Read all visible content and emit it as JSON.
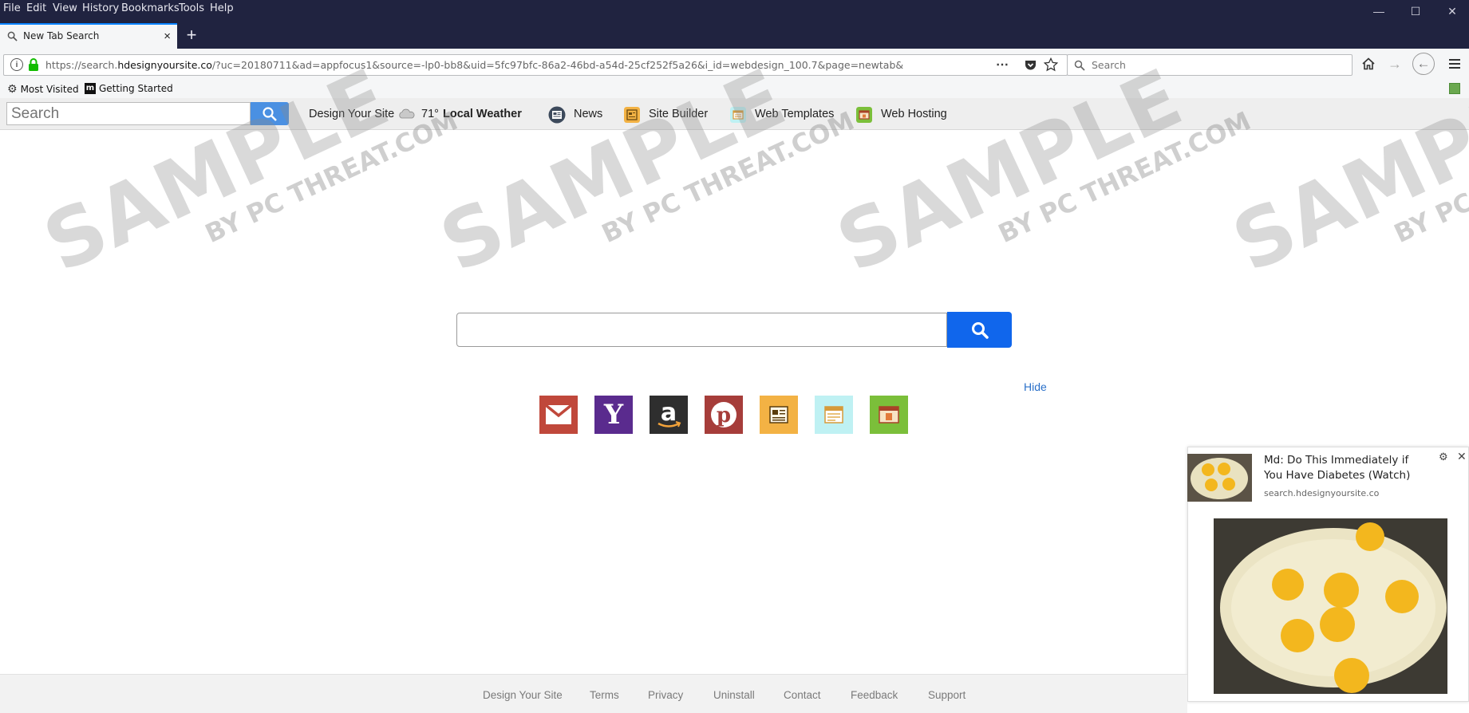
{
  "menu": [
    "File",
    "Edit",
    "View",
    "History",
    "Bookmarks",
    "Tools",
    "Help"
  ],
  "tab": {
    "title": "New Tab Search",
    "close": "×",
    "new_tab": "+"
  },
  "url": {
    "prefix": "https://search.",
    "domain": "hdesignyoursite.co",
    "rest": "/?uc=20180711&ad=appfocus1&source=-lp0-bb8&uid=5fc97bfc-86a2-46bd-a54d-25cf252f5a26&i_id=webdesign_100.7&page=newtab&"
  },
  "browser_search": {
    "placeholder": "Search"
  },
  "bookmarks": [
    {
      "label": "Most Visited",
      "icon": "gear-icon"
    },
    {
      "label": "Getting Started",
      "icon": "m-logo-icon"
    }
  ],
  "toolbar": {
    "search_placeholder": "Search",
    "design_your_site": "Design Your Site",
    "weather_temp": "71°",
    "weather_label": "Local Weather",
    "news": "News",
    "site_builder": "Site Builder",
    "web_templates": "Web Templates",
    "web_hosting": "Web Hosting"
  },
  "watermark": {
    "big": "SAMPLE",
    "small": "BY PC THREAT.COM"
  },
  "main": {
    "hide": "Hide"
  },
  "tiles": [
    {
      "name": "gmail-tile",
      "icon": "mail-icon",
      "color": "#c0483b"
    },
    {
      "name": "yahoo-tile",
      "icon": "yahoo-icon",
      "color": "#5a2b8e"
    },
    {
      "name": "amazon-tile",
      "icon": "amazon-icon",
      "color": "#2e2e2e"
    },
    {
      "name": "pinterest-tile",
      "icon": "pinterest-icon",
      "color": "#a63d3a"
    },
    {
      "name": "site-builder-tile",
      "icon": "site-builder-icon",
      "color": "#f3b244"
    },
    {
      "name": "web-templates-tile",
      "icon": "web-templates-icon",
      "color": "#bff1f3"
    },
    {
      "name": "web-hosting-tile",
      "icon": "web-hosting-icon",
      "color": "#7bbf3a"
    }
  ],
  "ad": {
    "title": "Md: Do This Immediately if You Have Diabetes (Watch)",
    "source": "search.hdesignyoursite.co"
  },
  "footer": [
    "Design Your Site",
    "Terms",
    "Privacy",
    "Uninstall",
    "Contact",
    "Feedback",
    "Support"
  ],
  "colors": {
    "titlebar": "#202340",
    "accent": "#0a84ff",
    "search_button": "#1066ec",
    "link": "#2a70c9"
  }
}
